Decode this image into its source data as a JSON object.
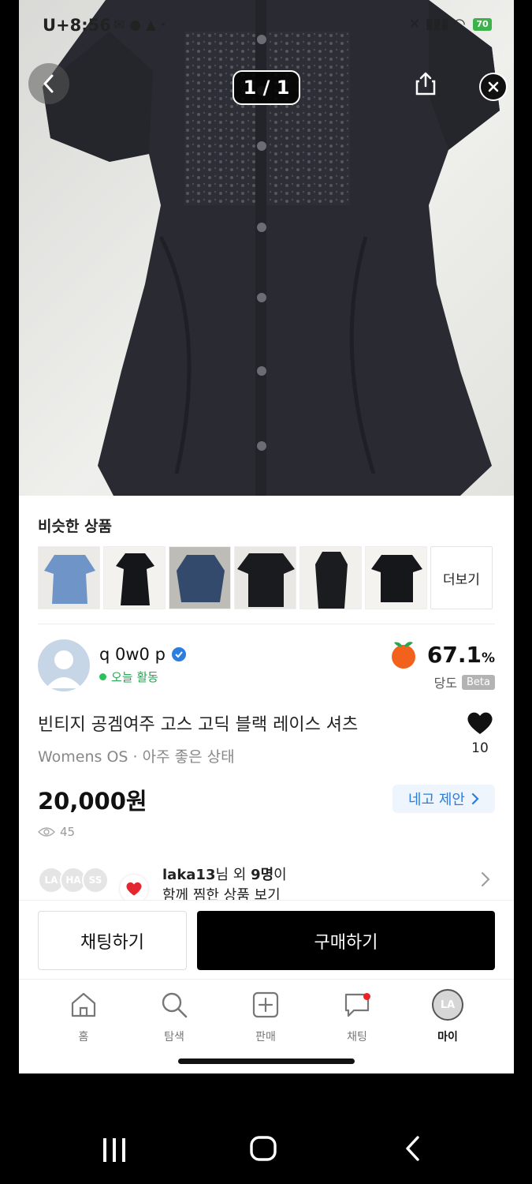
{
  "status_bar": {
    "time": "U+8:56",
    "battery": "70"
  },
  "hero": {
    "counter": "1 / 1"
  },
  "similar": {
    "title": "비슷한 상품",
    "more_label": "더보기"
  },
  "seller": {
    "name": "q 0w0 p",
    "activity": "오늘 활동",
    "score_value": "67.1",
    "score_unit": "%",
    "score_label": "당도",
    "beta": "Beta"
  },
  "product": {
    "title": "빈티지 공겜여주 고스 고딕 블랙 레이스 셔츠",
    "meta": "Womens OS · 아주 좋은 상태",
    "likes": "10",
    "price": "20,000원",
    "offer_label": "네고 제안",
    "views": "45"
  },
  "likers": {
    "avatars": [
      "LA",
      "HA",
      "SS"
    ],
    "name": "laka13",
    "suffix1": "님 외 ",
    "count": "9명",
    "suffix2": "이",
    "line2": "함께 찜한 상품 보기"
  },
  "actions": {
    "chat": "채팅하기",
    "buy": "구매하기"
  },
  "tabs": [
    {
      "label": "홈",
      "icon": "home-icon"
    },
    {
      "label": "탐색",
      "icon": "search-icon"
    },
    {
      "label": "판매",
      "icon": "plus-square-icon"
    },
    {
      "label": "채팅",
      "icon": "chat-bubble-icon"
    },
    {
      "label": "마이",
      "icon": "avatar-icon",
      "avatar_text": "LA"
    }
  ],
  "colors": {
    "accent_blue": "#2b7de0",
    "active_green": "#2bc15a",
    "buy_button": "#000000"
  }
}
